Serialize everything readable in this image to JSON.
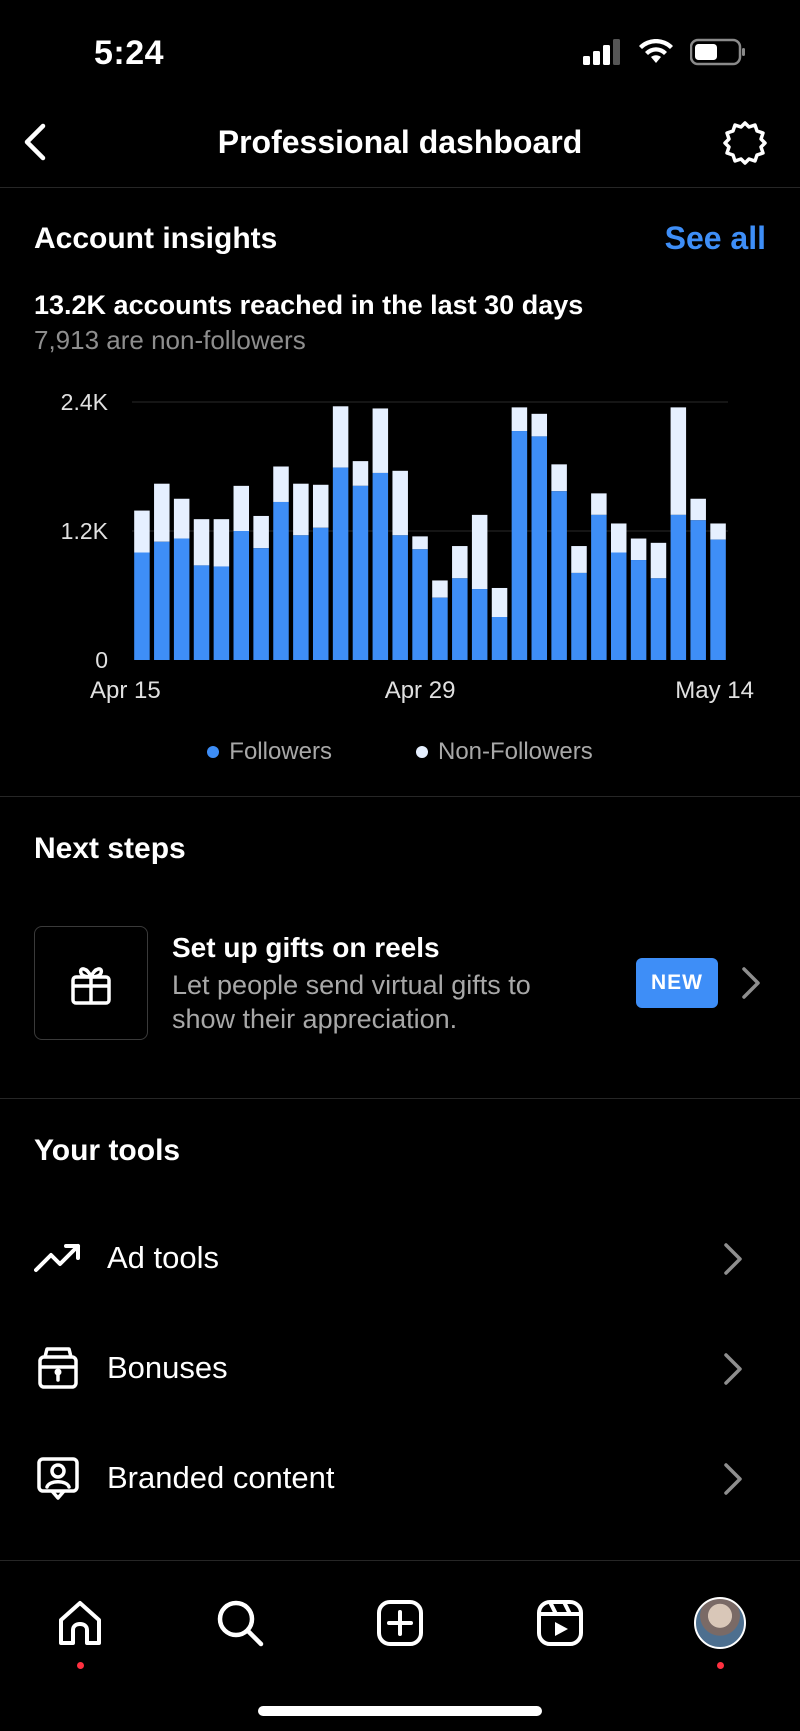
{
  "status_bar": {
    "time": "5:24"
  },
  "header": {
    "title": "Professional dashboard"
  },
  "insights": {
    "title": "Account insights",
    "see_all": "See all",
    "reach_text": "13.2K accounts reached in the last 30 days",
    "nonfollower_text": "7,913 are non-followers",
    "legend": {
      "followers": "Followers",
      "non_followers": "Non-Followers"
    }
  },
  "chart_data": {
    "type": "bar",
    "stacked": true,
    "ylim": [
      0,
      2400
    ],
    "yticks": [
      "0",
      "1.2K",
      "2.4K"
    ],
    "xtick_labels": [
      {
        "label": "Apr 15",
        "index": 0
      },
      {
        "label": "Apr 29",
        "index": 14
      },
      {
        "label": "May 14",
        "index": 29
      }
    ],
    "grid": true,
    "legend_position": "bottom",
    "colors": {
      "followers": "#3e8ef7",
      "non_followers": "#e6f0ff"
    },
    "series": [
      {
        "name": "Followers",
        "values": [
          1000,
          1100,
          1130,
          880,
          870,
          1200,
          1040,
          1470,
          1160,
          1230,
          1790,
          1620,
          1740,
          1160,
          1030,
          580,
          760,
          660,
          400,
          2130,
          2080,
          1570,
          810,
          1350,
          1000,
          930,
          760,
          1350,
          1300,
          1120
        ]
      },
      {
        "name": "Non-Followers",
        "values": [
          390,
          540,
          370,
          430,
          440,
          420,
          300,
          330,
          480,
          400,
          570,
          230,
          600,
          600,
          120,
          160,
          300,
          690,
          270,
          220,
          210,
          250,
          250,
          200,
          270,
          200,
          330,
          1000,
          200,
          150
        ]
      }
    ]
  },
  "next_steps": {
    "title": "Next steps",
    "card_title": "Set up gifts on reels",
    "card_desc": "Let people send virtual gifts to show their appreciation.",
    "badge": "NEW"
  },
  "tools": {
    "title": "Your tools",
    "items": [
      {
        "label": "Ad tools",
        "icon": "trending-up-icon"
      },
      {
        "label": "Bonuses",
        "icon": "bonus-box-icon"
      },
      {
        "label": "Branded content",
        "icon": "branded-content-icon"
      }
    ]
  },
  "tab_bar": {
    "items": [
      "home-icon",
      "search-icon",
      "create-icon",
      "reels-icon",
      "profile-avatar"
    ]
  }
}
